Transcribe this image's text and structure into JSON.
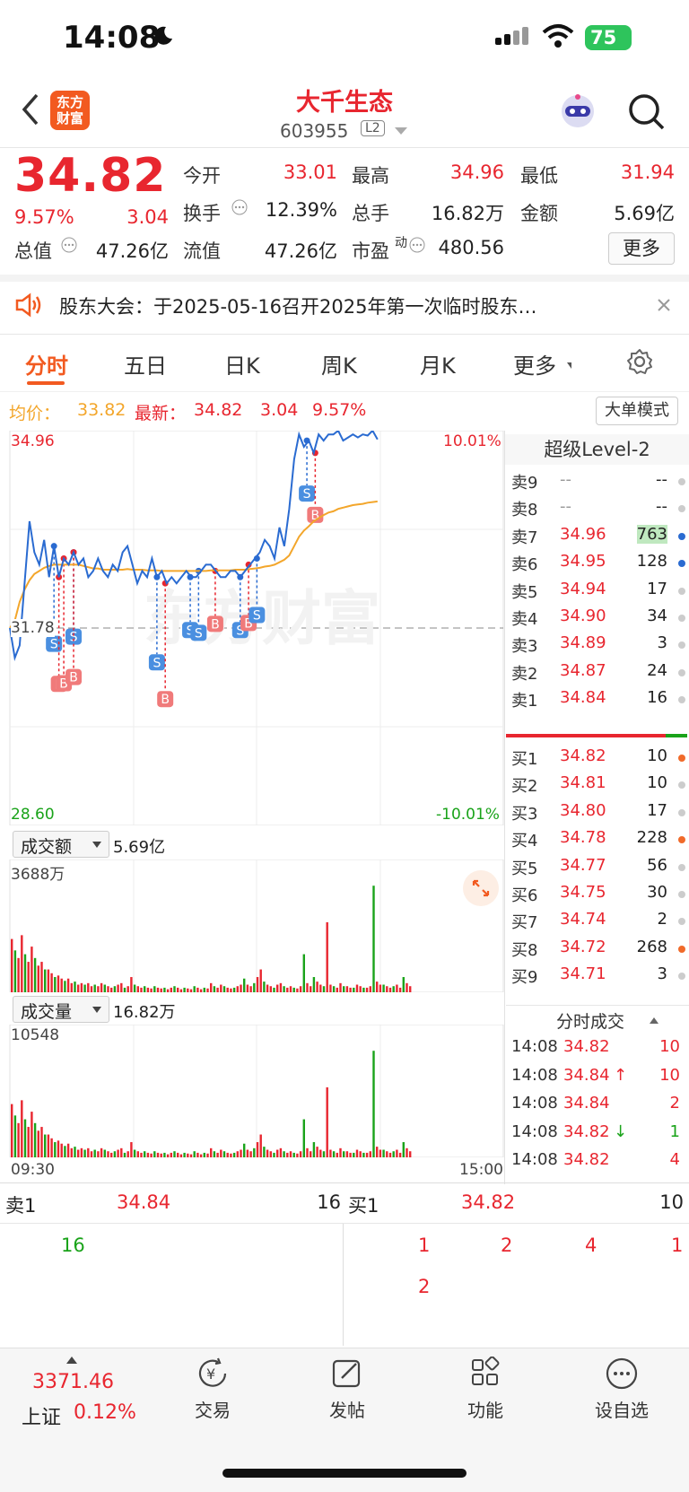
{
  "status_bar": {
    "time": "14:08",
    "battery": "75"
  },
  "header": {
    "logo_text": "东方财富",
    "stock_name": "大千生态",
    "stock_code": "603955",
    "level_badge": "L2"
  },
  "quote": {
    "price": "34.82",
    "change_pct": "9.57%",
    "change": "3.04",
    "fields": [
      {
        "label": "今开",
        "value": "33.01"
      },
      {
        "label": "最高",
        "value": "34.96"
      },
      {
        "label": "最低",
        "value": "31.94"
      },
      {
        "label": "换手",
        "value": "12.39%"
      },
      {
        "label": "总手",
        "value": "16.82万"
      },
      {
        "label": "金额",
        "value": "5.69亿"
      },
      {
        "label": "总值",
        "value": "47.26亿"
      },
      {
        "label": "流值",
        "value": "47.26亿"
      },
      {
        "label": "市盈",
        "sup": "动",
        "value": "480.56"
      }
    ],
    "more_label": "更多"
  },
  "notice": {
    "text": "股东大会：于2025-05-16召开2025年第一次临时股东…"
  },
  "tabs": [
    "分时",
    "五日",
    "日K",
    "周K",
    "月K",
    "更多"
  ],
  "chart_info": {
    "avg_label": "均价：",
    "avg_value": "33.82",
    "latest_label": "最新：",
    "latest_value": "34.82",
    "latest_change": "3.04",
    "latest_pct": "9.57%",
    "big_order_label": "大单模式",
    "y_top": "34.96",
    "y_top_pct": "10.01%",
    "y_mid": "31.78",
    "y_bottom": "28.60",
    "y_bottom_pct": "-10.01%",
    "watermark": "东方财富",
    "amount_label": "成交额",
    "amount_value": "5.69亿",
    "amount_max": "3688万",
    "volume_label": "成交量",
    "volume_value": "16.82万",
    "volume_max": "10548",
    "time_start": "09:30",
    "time_end": "15:00"
  },
  "chart_data": {
    "type": "line",
    "ylim": [
      28.6,
      34.96
    ],
    "reference_price": 31.78,
    "price": [
      31.78,
      31.3,
      31.5,
      32.5,
      33.5,
      33.0,
      32.8,
      33.2,
      32.6,
      33.1,
      32.6,
      32.9,
      32.8,
      33.0,
      32.8,
      32.9,
      32.6,
      32.7,
      32.9,
      32.7,
      32.6,
      32.8,
      32.7,
      33.0,
      33.1,
      32.8,
      32.5,
      32.7,
      32.6,
      32.9,
      32.6,
      32.7,
      32.5,
      32.6,
      32.5,
      32.6,
      32.7,
      32.6,
      32.6,
      32.7,
      32.8,
      32.8,
      32.7,
      32.6,
      32.6,
      32.7,
      32.7,
      32.6,
      32.7,
      32.8,
      32.9,
      33.0,
      33.2,
      33.1,
      32.9,
      33.4,
      33.1,
      33.7,
      34.5,
      34.9,
      34.7,
      34.8,
      34.6,
      34.9,
      34.8,
      34.9,
      34.9,
      34.96,
      34.8,
      34.85,
      34.9,
      34.85,
      34.9,
      34.88,
      34.96,
      34.82
    ],
    "avg": [
      31.78,
      31.9,
      32.2,
      32.4,
      32.55,
      32.65,
      32.7,
      32.75,
      32.78,
      32.8,
      32.8,
      32.8,
      32.8,
      32.8,
      32.8,
      32.78,
      32.76,
      32.74,
      32.74,
      32.72,
      32.72,
      32.72,
      32.72,
      32.72,
      32.73,
      32.72,
      32.72,
      32.72,
      32.71,
      32.71,
      32.71,
      32.7,
      32.7,
      32.7,
      32.7,
      32.7,
      32.7,
      32.7,
      32.7,
      32.7,
      32.7,
      32.71,
      32.71,
      32.71,
      32.71,
      32.71,
      32.72,
      32.72,
      32.72,
      32.73,
      32.74,
      32.75,
      32.77,
      32.78,
      32.8,
      32.84,
      32.88,
      32.95,
      33.1,
      33.25,
      33.35,
      33.42,
      33.5,
      33.55,
      33.6,
      33.64,
      33.66,
      33.7,
      33.72,
      33.74,
      33.76,
      33.77,
      33.78,
      33.8,
      33.81,
      33.82
    ]
  },
  "order_book": {
    "title": "超级Level-2",
    "sells": [
      {
        "label": "卖9",
        "price": "--",
        "vol": "--",
        "dot": "#cccccc"
      },
      {
        "label": "卖8",
        "price": "--",
        "vol": "--",
        "dot": "#cccccc"
      },
      {
        "label": "卖7",
        "price": "34.96",
        "vol": "763",
        "dot": "#2a6bd1"
      },
      {
        "label": "卖6",
        "price": "34.95",
        "vol": "128",
        "dot": "#2a6bd1"
      },
      {
        "label": "卖5",
        "price": "34.94",
        "vol": "17",
        "dot": "#cccccc"
      },
      {
        "label": "卖4",
        "price": "34.90",
        "vol": "34",
        "dot": "#cccccc"
      },
      {
        "label": "卖3",
        "price": "34.89",
        "vol": "3",
        "dot": "#cccccc"
      },
      {
        "label": "卖2",
        "price": "34.87",
        "vol": "24",
        "dot": "#cccccc"
      },
      {
        "label": "卖1",
        "price": "34.84",
        "vol": "16",
        "dot": "#cccccc"
      }
    ],
    "buys": [
      {
        "label": "买1",
        "price": "34.82",
        "vol": "10",
        "dot": "#f06a2a"
      },
      {
        "label": "买2",
        "price": "34.81",
        "vol": "10",
        "dot": "#cccccc"
      },
      {
        "label": "买3",
        "price": "34.80",
        "vol": "17",
        "dot": "#cccccc"
      },
      {
        "label": "买4",
        "price": "34.78",
        "vol": "228",
        "dot": "#f06a2a"
      },
      {
        "label": "买5",
        "price": "34.77",
        "vol": "56",
        "dot": "#cccccc"
      },
      {
        "label": "买6",
        "price": "34.75",
        "vol": "30",
        "dot": "#cccccc"
      },
      {
        "label": "买7",
        "price": "34.74",
        "vol": "2",
        "dot": "#cccccc"
      },
      {
        "label": "买8",
        "price": "34.72",
        "vol": "268",
        "dot": "#f06a2a"
      },
      {
        "label": "买9",
        "price": "34.71",
        "vol": "3",
        "dot": "#cccccc"
      }
    ],
    "ticks_title": "分时成交",
    "ticks": [
      {
        "time": "14:08",
        "price": "34.82",
        "arrow": "",
        "vol": "10"
      },
      {
        "time": "14:08",
        "price": "34.84",
        "arrow": "↑",
        "vol": "10"
      },
      {
        "time": "14:08",
        "price": "34.84",
        "arrow": "",
        "vol": "2"
      },
      {
        "time": "14:08",
        "price": "34.82",
        "arrow": "↓",
        "vol": "1"
      },
      {
        "time": "14:08",
        "price": "34.82",
        "arrow": "",
        "vol": "4"
      }
    ]
  },
  "bottom_panel": {
    "sell1_label": "卖1",
    "sell1_price": "34.84",
    "sell1_vol": "16",
    "buy1_label": "买1",
    "buy1_price": "34.82",
    "buy1_vol": "10",
    "sell_queue": [
      "16"
    ],
    "buy_queue": [
      "1",
      "2",
      "4",
      "1",
      "2"
    ]
  },
  "bottom_nav": {
    "index_value": "3371.46",
    "index_name": "上证",
    "index_pct": "0.12%",
    "items": [
      "交易",
      "发帖",
      "功能",
      "设自选"
    ]
  },
  "colors": {
    "up": "#e8262f",
    "down": "#1aa31a",
    "accent": "#f25a20",
    "avg_line": "#f3a62b",
    "price_line": "#2a6bd1"
  }
}
